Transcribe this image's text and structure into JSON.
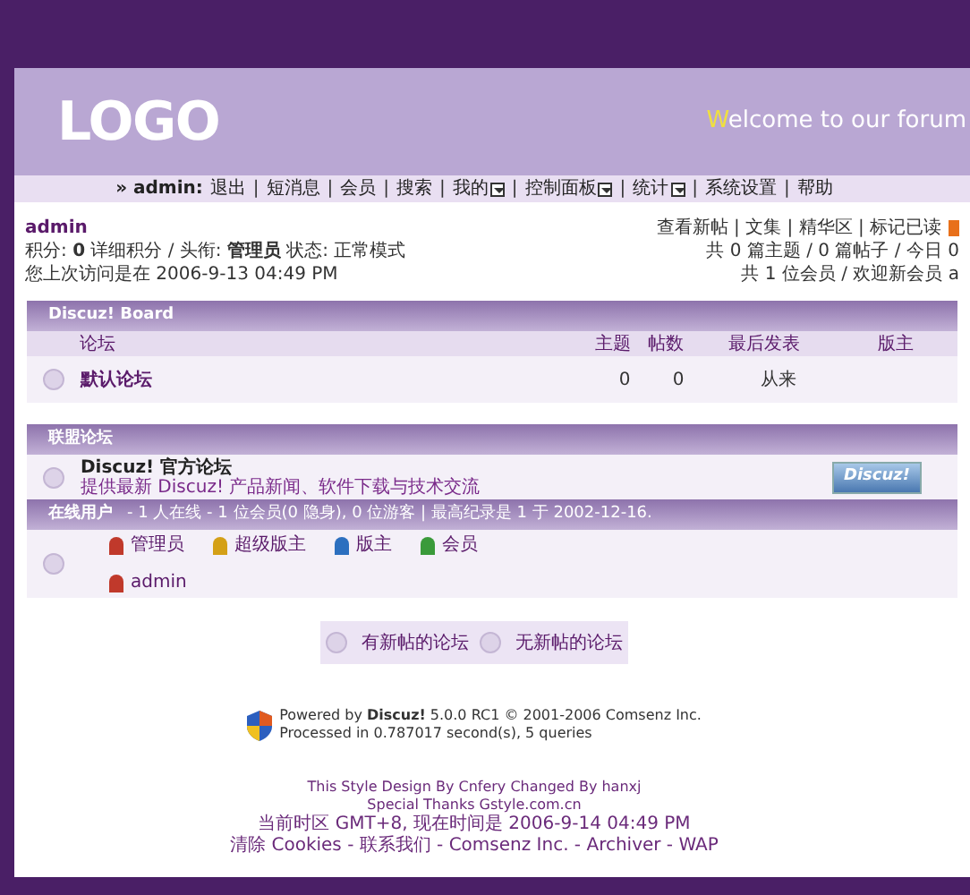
{
  "header": {
    "logo": "LOGO",
    "welcome_initial": "W",
    "welcome_rest": "elcome to our forum"
  },
  "nav": {
    "user": "» admin:",
    "separator": "|",
    "links": [
      "退出",
      "短消息",
      "会员",
      "搜索",
      "我的",
      "控制面板",
      "统计",
      "系统设置",
      "帮助"
    ],
    "dropdowns": [
      false,
      false,
      false,
      false,
      true,
      true,
      true,
      false,
      false
    ]
  },
  "user_info": {
    "name": "admin",
    "line_1": "积分: **0** 详细积分 / 头衔: **管理员** 状态: 正常模式",
    "line_2": "您上次访问是在 2006-9-13 04:49 PM"
  },
  "quick_links": {
    "line_1": "查看新帖 | 文集 | 精华区 | 标记已读",
    "line_2": "共 0 篇主题 / 0 篇帖子 / 今日 0",
    "line_3": "共 1 位会员 / 欢迎新会员 a"
  },
  "board": {
    "title": "Discuz! Board",
    "columns": [
      "论坛",
      "主题",
      "帖数",
      "最后发表",
      "版主"
    ],
    "rows": [
      {
        "name": "默认论坛",
        "topics": "0",
        "posts": "0",
        "last_post": "从来"
      }
    ]
  },
  "league": {
    "title": "联盟论坛",
    "items": [
      {
        "name": "Discuz! 官方论坛",
        "description": "提供最新 Discuz! 产品新闻、软件下载与技术交流",
        "banner": "Discuz!"
      }
    ]
  },
  "online": {
    "title": "在线用户",
    "summary": "- 1 人在线 - 1 位会员(0 隐身), 0 位游客 | 最高纪录是 1 于 2002-12-16.",
    "legend": [
      {
        "label": "管理员",
        "color": "#c0392b"
      },
      {
        "label": "超级版主",
        "color": "#d4a017"
      },
      {
        "label": "版主",
        "color": "#2c6fbf"
      },
      {
        "label": "会员",
        "color": "#3a9a3a"
      }
    ],
    "users": [
      {
        "name": "admin",
        "color": "#c0392b"
      }
    ]
  },
  "legend": [
    "有新帖的论坛",
    "无新帖的论坛"
  ],
  "footer": {
    "powered": "Powered by **Discuz!** 5.0.0 RC1  © 2001-2006 Comsenz Inc.",
    "processed": "Processed in 0.787017 second(s), 5 queries",
    "style_credit": "This Style Design By Cnfery Changed By hanxj",
    "thanks": "Special Thanks Gstyle.com.cn",
    "time": "当前时区 GMT+8, 现在时间是 2006-9-14 04:49 PM",
    "links": "清除 Cookies - 联系我们 - Comsenz Inc. - Archiver - WAP"
  }
}
